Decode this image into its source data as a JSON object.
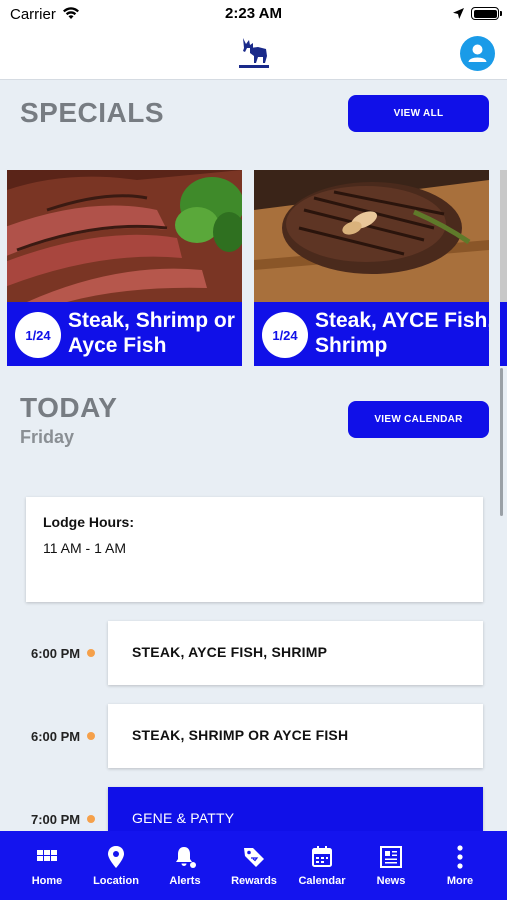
{
  "status": {
    "carrier": "Carrier",
    "time": "2:23 AM"
  },
  "specials": {
    "title": "SPECIALS",
    "view_all": "VIEW ALL",
    "cards": [
      {
        "date": "1/24",
        "title": "Steak, Shrimp or Ayce Fish"
      },
      {
        "date": "1/24",
        "title": "Steak, AYCE Fish, Shrimp"
      }
    ]
  },
  "today": {
    "title": "TODAY",
    "day": "Friday",
    "view_calendar": "VIEW CALENDAR",
    "hours_label": "Lodge Hours:",
    "hours_value": "11 AM - 1 AM",
    "events": [
      {
        "time": "6:00 PM",
        "title": "STEAK, AYCE FISH, SHRIMP"
      },
      {
        "time": "6:00 PM",
        "title": "STEAK, SHRIMP  OR AYCE FISH"
      },
      {
        "time": "7:00 PM",
        "title": "GENE & PATTY"
      }
    ]
  },
  "tabs": [
    {
      "label": "Home",
      "icon": "home-grid-icon"
    },
    {
      "label": "Location",
      "icon": "location-pin-icon"
    },
    {
      "label": "Alerts",
      "icon": "bell-icon"
    },
    {
      "label": "Rewards",
      "icon": "tag-icon"
    },
    {
      "label": "Calendar",
      "icon": "calendar-icon"
    },
    {
      "label": "News",
      "icon": "newspaper-icon"
    },
    {
      "label": "More",
      "icon": "more-vertical-icon"
    }
  ],
  "colors": {
    "accent": "#1010e8",
    "tabbar": "#1414ee",
    "avatar": "#1a9be8",
    "event_dot": "#f5a04a",
    "background": "#e8eef4"
  }
}
